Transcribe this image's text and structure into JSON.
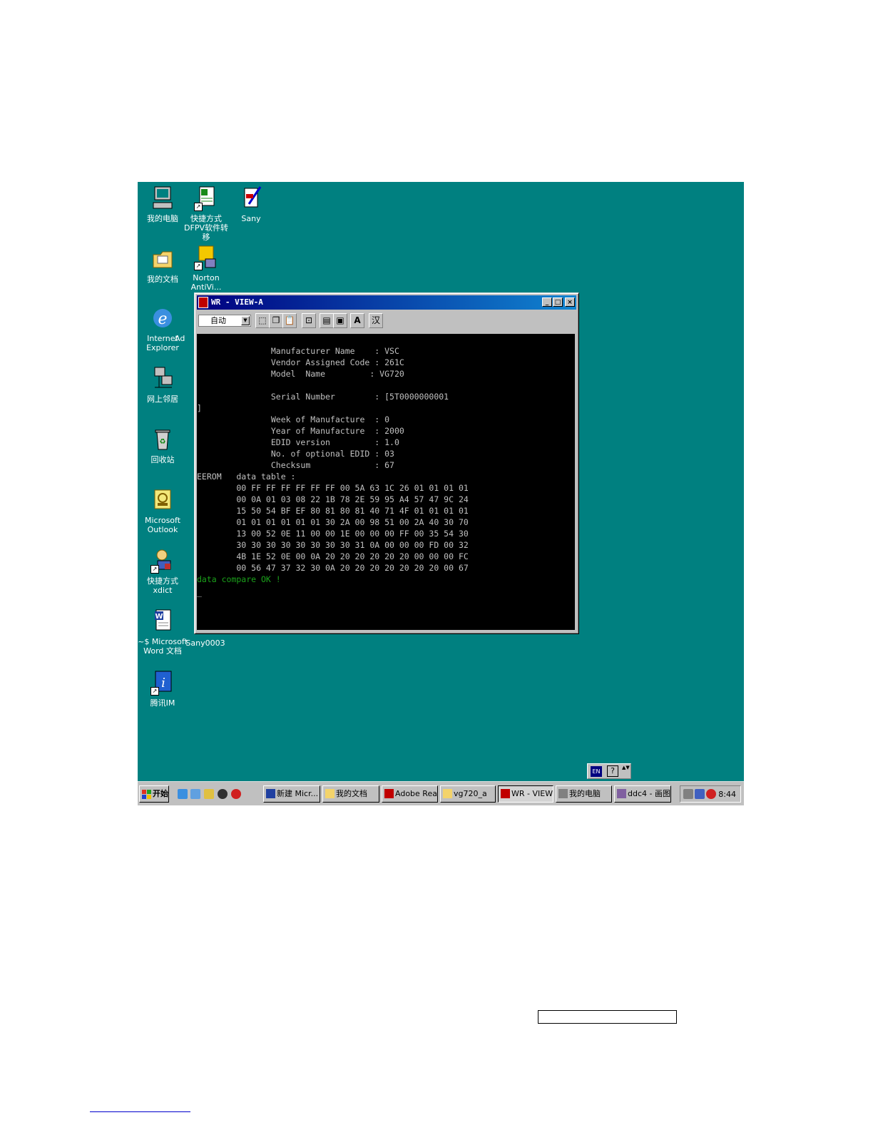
{
  "desktop_icons": [
    {
      "label": "我的电脑",
      "icon": "computer-icon"
    },
    {
      "label": "快捷方式\nDFPV软件转移",
      "icon": "excel-shortcut-icon"
    },
    {
      "label": "Sany",
      "icon": "document-pen-icon"
    },
    {
      "label": "我的文档",
      "icon": "folder-icon"
    },
    {
      "label": "Norton\nAntiVi...",
      "icon": "norton-icon"
    },
    {
      "label": "Internet\nExplorer",
      "icon": "ie-icon"
    },
    {
      "label": "Ad",
      "icon": "truncated-label"
    },
    {
      "label": "网上邻居",
      "icon": "network-icon"
    },
    {
      "label": "回收站",
      "icon": "recycle-bin-icon"
    },
    {
      "label": "Microsoft\nOutlook",
      "icon": "outlook-icon"
    },
    {
      "label": "快捷方式\nxdict",
      "icon": "xdict-icon"
    },
    {
      "label": "~$ Microsoft\nWord 文档",
      "icon": "word-doc-icon"
    },
    {
      "label": "Sany0003",
      "icon": "image-file-label"
    },
    {
      "label": "腾讯IM",
      "icon": "tencent-im-icon"
    }
  ],
  "window": {
    "title": "WR - VIEW-A",
    "toolbar_combo": "自动",
    "toolbar_a": "A",
    "toolbar_han": "汉",
    "min": "_",
    "max": "□",
    "close": "×"
  },
  "console_lines": [
    "               Manufacturer Name    : VSC",
    "               Vendor Assigned Code : 261C",
    "               Model  Name         : VG720",
    "",
    "               Serial Number        : [5T0000000001",
    "]",
    "               Week of Manufacture  : 0",
    "               Year of Manufacture  : 2000",
    "               EDID version         : 1.0",
    "               No. of optional EDID : 03",
    "               Checksum             : 67",
    "EEROM   data table :",
    "        00 FF FF FF FF FF FF 00 5A 63 1C 26 01 01 01 01",
    "        00 0A 01 03 08 22 1B 78 2E 59 95 A4 57 47 9C 24",
    "        15 50 54 BF EF 80 81 80 81 40 71 4F 01 01 01 01",
    "        01 01 01 01 01 01 30 2A 00 98 51 00 2A 40 30 70",
    "        13 00 52 0E 11 00 00 1E 00 00 00 FF 00 35 54 30",
    "        30 30 30 30 30 30 30 30 31 0A 00 00 00 FD 00 32",
    "        4B 1E 52 0E 00 0A 20 20 20 20 20 20 00 00 00 FC",
    "        00 56 47 37 32 30 0A 20 20 20 20 20 20 20 00 67"
  ],
  "console_ok": "data compare OK !",
  "console_cursor": "_",
  "ime": {
    "mode": "EN",
    "help": "?",
    "spin": "▲▼"
  },
  "taskbar": {
    "start": "开始",
    "tasks": [
      "新建 Micr...",
      "我的文档",
      "Adobe Rea...",
      "vg720_a",
      "WR - VIEW-A",
      "我的电脑",
      "ddc4 - 画图"
    ],
    "active_task": "WR - VIEW-A",
    "clock": "8:44"
  },
  "colors": {
    "desktop": "#008080",
    "console_bg": "#000000",
    "console_text": "#c0c0c0",
    "ok_text": "#1ba21b",
    "titlebar": "#000080"
  }
}
